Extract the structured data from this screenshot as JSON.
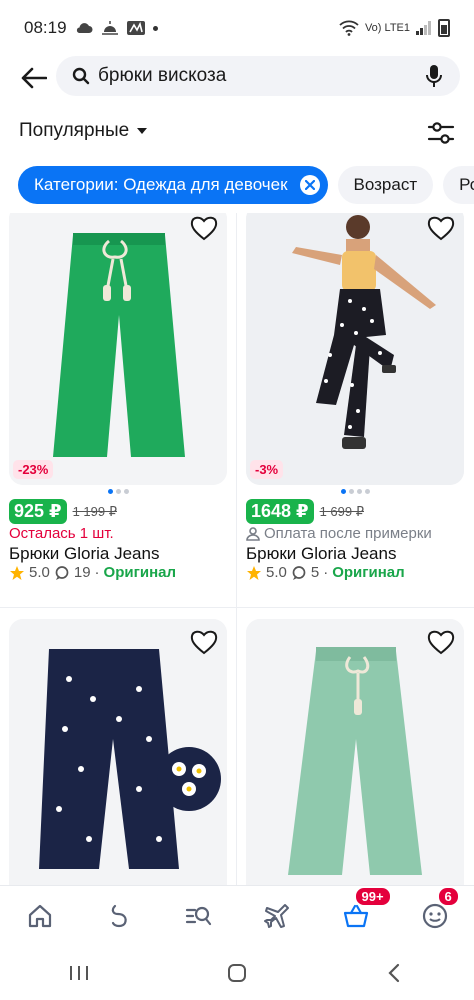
{
  "status_bar": {
    "time": "08:19",
    "network": "Vo) LTE1"
  },
  "search": {
    "back_label": "back",
    "query": "брюки вискоза"
  },
  "sort": {
    "label": "Популярные"
  },
  "chips": [
    {
      "label": "Категории: Одежда для девочек"
    },
    {
      "label": "Возраст"
    },
    {
      "label": "Ро"
    }
  ],
  "products": [
    {
      "discount": "-23%",
      "price": "925 ₽",
      "old_price": "1 199 ₽",
      "note": "Осталась 1 шт.",
      "title": "Брюки Gloria Jeans",
      "rating": "5.0",
      "reviews": "19",
      "original": "Оригинал",
      "fabric_color": "#1faa5c"
    },
    {
      "discount": "-3%",
      "price": "1648 ₽",
      "old_price": "1 699 ₽",
      "note": "Оплата после примерки",
      "title": "Брюки Gloria Jeans",
      "rating": "5.0",
      "reviews": "5",
      "original": "Оригинал",
      "fabric_color": "#1c1c24"
    },
    {
      "fabric_color": "#1b2446"
    },
    {
      "fabric_color": "#8fc9ad"
    }
  ],
  "bottom_nav": {
    "items": [
      "home-icon",
      "assistant-icon",
      "catalog-search-icon",
      "travel-icon",
      "cart-icon",
      "profile-icon"
    ],
    "cart_badge": "99+",
    "profile_badge": "6"
  },
  "colors": {
    "accent": "#0a74f5",
    "price_green": "#19b34b",
    "sale_red": "#e4003c"
  }
}
